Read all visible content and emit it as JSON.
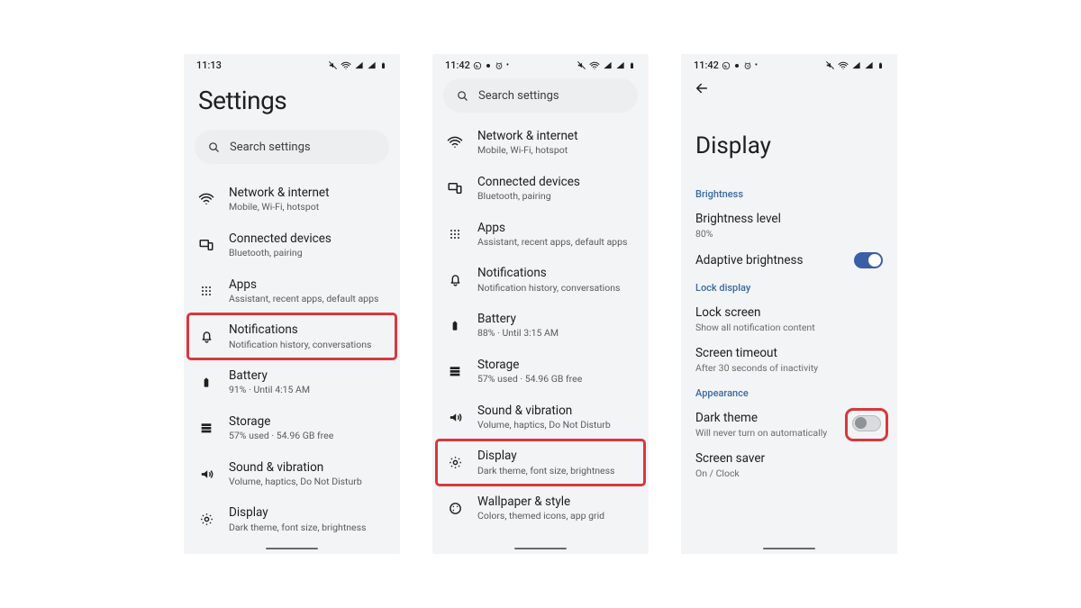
{
  "screens": {
    "s1": {
      "time": "11:13",
      "title": "Settings",
      "search_placeholder": "Search settings",
      "items": [
        {
          "label": "Network & internet",
          "sub": "Mobile, Wi-Fi, hotspot"
        },
        {
          "label": "Connected devices",
          "sub": "Bluetooth, pairing"
        },
        {
          "label": "Apps",
          "sub": "Assistant, recent apps, default apps"
        },
        {
          "label": "Notifications",
          "sub": "Notification history, conversations"
        },
        {
          "label": "Battery",
          "sub": "91% · Until 4:15 AM"
        },
        {
          "label": "Storage",
          "sub": "57% used · 54.96 GB free"
        },
        {
          "label": "Sound & vibration",
          "sub": "Volume, haptics, Do Not Disturb"
        },
        {
          "label": "Display",
          "sub": "Dark theme, font size, brightness"
        }
      ]
    },
    "s2": {
      "time": "11:42",
      "search_placeholder": "Search settings",
      "items": [
        {
          "label": "Network & internet",
          "sub": "Mobile, Wi-Fi, hotspot"
        },
        {
          "label": "Connected devices",
          "sub": "Bluetooth, pairing"
        },
        {
          "label": "Apps",
          "sub": "Assistant, recent apps, default apps"
        },
        {
          "label": "Notifications",
          "sub": "Notification history, conversations"
        },
        {
          "label": "Battery",
          "sub": "88% · Until 3:15 AM"
        },
        {
          "label": "Storage",
          "sub": "57% used · 54.96 GB free"
        },
        {
          "label": "Sound & vibration",
          "sub": "Volume, haptics, Do Not Disturb"
        },
        {
          "label": "Display",
          "sub": "Dark theme, font size, brightness"
        },
        {
          "label": "Wallpaper & style",
          "sub": "Colors, themed icons, app grid"
        }
      ]
    },
    "s3": {
      "time": "11:42",
      "title": "Display",
      "sections": {
        "brightness_hdr": "Brightness",
        "brightness_level": {
          "label": "Brightness level",
          "sub": "80%"
        },
        "adaptive": {
          "label": "Adaptive brightness"
        },
        "lock_hdr": "Lock display",
        "lock_screen": {
          "label": "Lock screen",
          "sub": "Show all notification content"
        },
        "timeout": {
          "label": "Screen timeout",
          "sub": "After 30 seconds of inactivity"
        },
        "appearance_hdr": "Appearance",
        "dark": {
          "label": "Dark theme",
          "sub": "Will never turn on automatically"
        },
        "saver": {
          "label": "Screen saver",
          "sub": "On / Clock"
        }
      }
    },
    "highlight_color": "#d7383d"
  }
}
